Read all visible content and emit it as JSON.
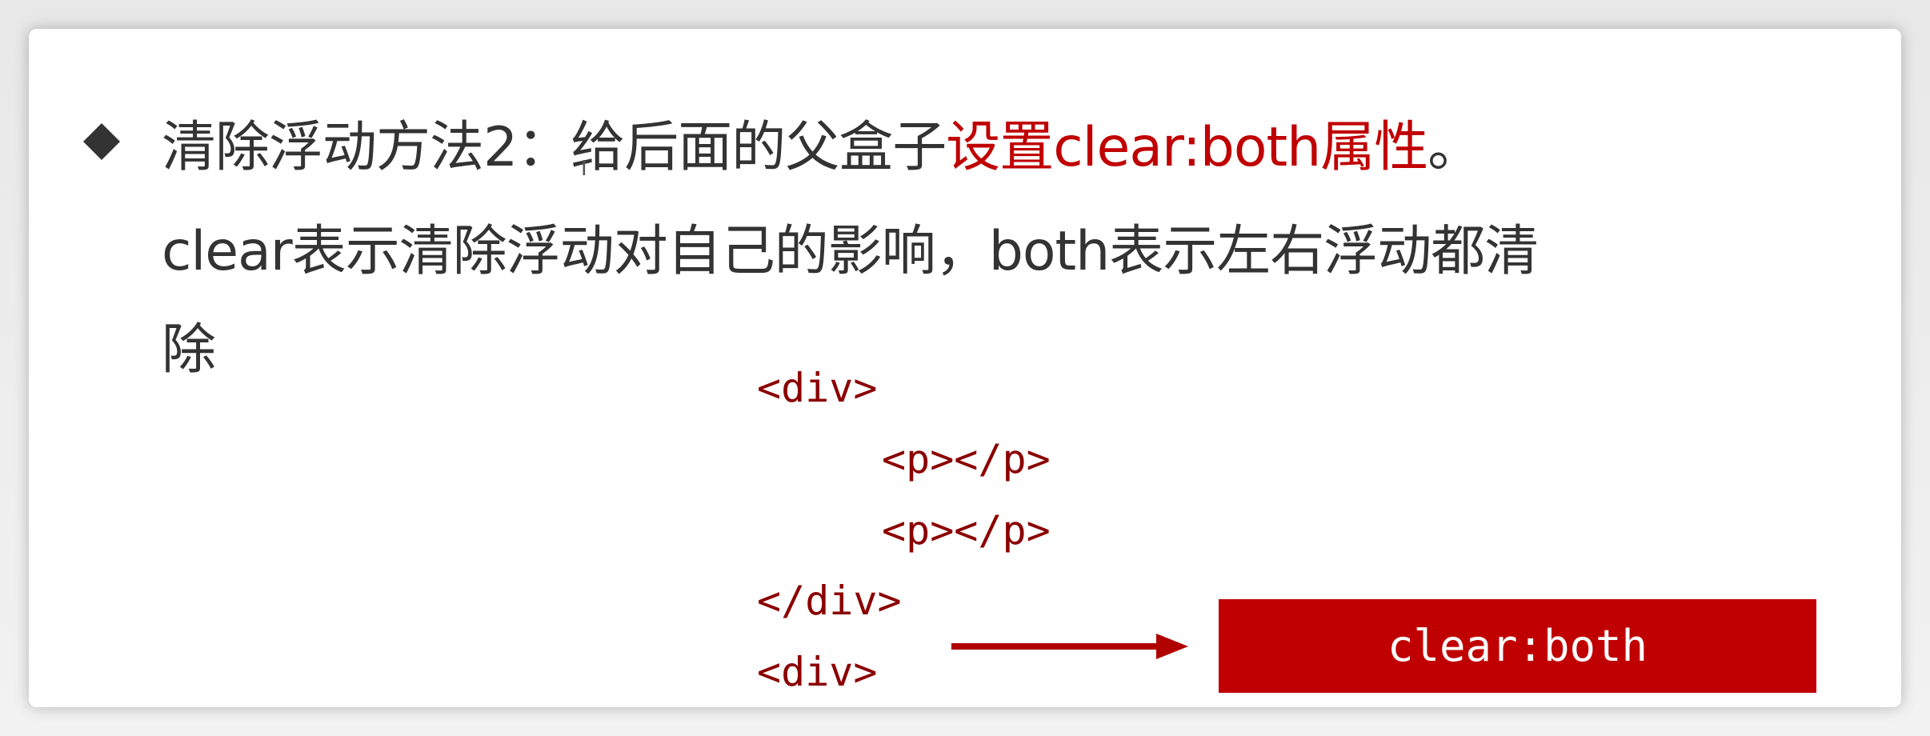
{
  "slide": {
    "bullet_icon": "diamond-icon",
    "line1_prefix": "清除浮动方法2：给后面的父盒子",
    "line1_highlight": "设置clear:both属性",
    "line1_suffix": "。",
    "line2": "clear表示清除浮动对自己的影响，both表示左右浮动都清",
    "line3": "除",
    "highlight_color": "#c00000",
    "code_lines": [
      "<div>",
      "<p></p>",
      "<p></p>",
      "</div>",
      "<div>"
    ],
    "annotation": "clear:both"
  }
}
